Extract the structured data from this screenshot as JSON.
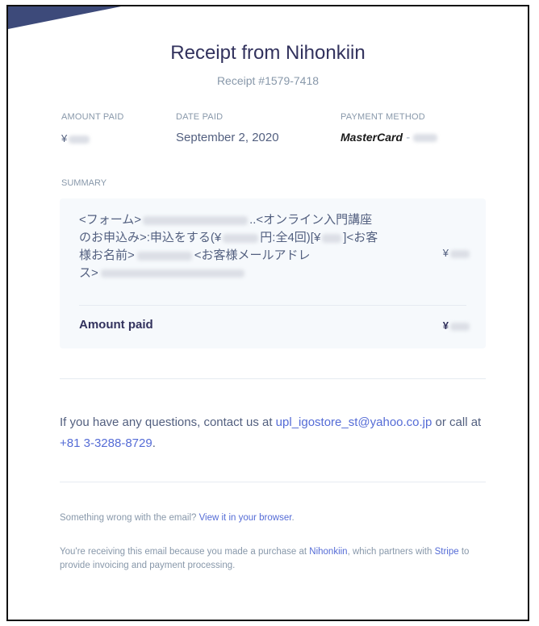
{
  "receipt": {
    "title": "Receipt from Nihonkiin",
    "number": "Receipt #1579-7418"
  },
  "meta": {
    "amount_paid_label": "AMOUNT PAID",
    "amount_paid_value": "¥",
    "date_paid_label": "DATE PAID",
    "date_paid_value": "September 2, 2020",
    "payment_method_label": "PAYMENT METHOD",
    "payment_brand": "MasterCard",
    "payment_dash": " - "
  },
  "summary": {
    "label": "SUMMARY",
    "line1_a": "<フォーム>",
    "line1_b": "..<オンライン入門講座",
    "line2_a": "のお申込み>:申込をする(¥",
    "line2_b": "円:全4回)[¥",
    "line2_c": "]<お客",
    "line3_a": "様お名前>",
    "line3_b": "<お客様メールアドレ",
    "line4_a": "ス>",
    "item_amount": "¥",
    "amount_paid_label": "Amount paid",
    "amount_paid_value": "¥"
  },
  "contact": {
    "prefix": "If you have any questions, contact us at ",
    "email": "upl_igostore_st@yahoo.co.jp",
    "middle": " or call at ",
    "phone": "+81 3-3288-8729",
    "suffix": "."
  },
  "footer": {
    "wrong_prefix": "Something wrong with the email? ",
    "view_link": "View it in your browser",
    "wrong_suffix": ".",
    "receiving_prefix": "You're receiving this email because you made a purchase at ",
    "merchant_link": "Nihonkiin",
    "receiving_middle": ", which partners with ",
    "stripe_link": "Stripe",
    "receiving_suffix": " to provide invoicing and payment processing."
  },
  "colors": {
    "link": "#556cd6",
    "banner": "#3d4a7a",
    "summary_bg": "#f6f9fc"
  }
}
